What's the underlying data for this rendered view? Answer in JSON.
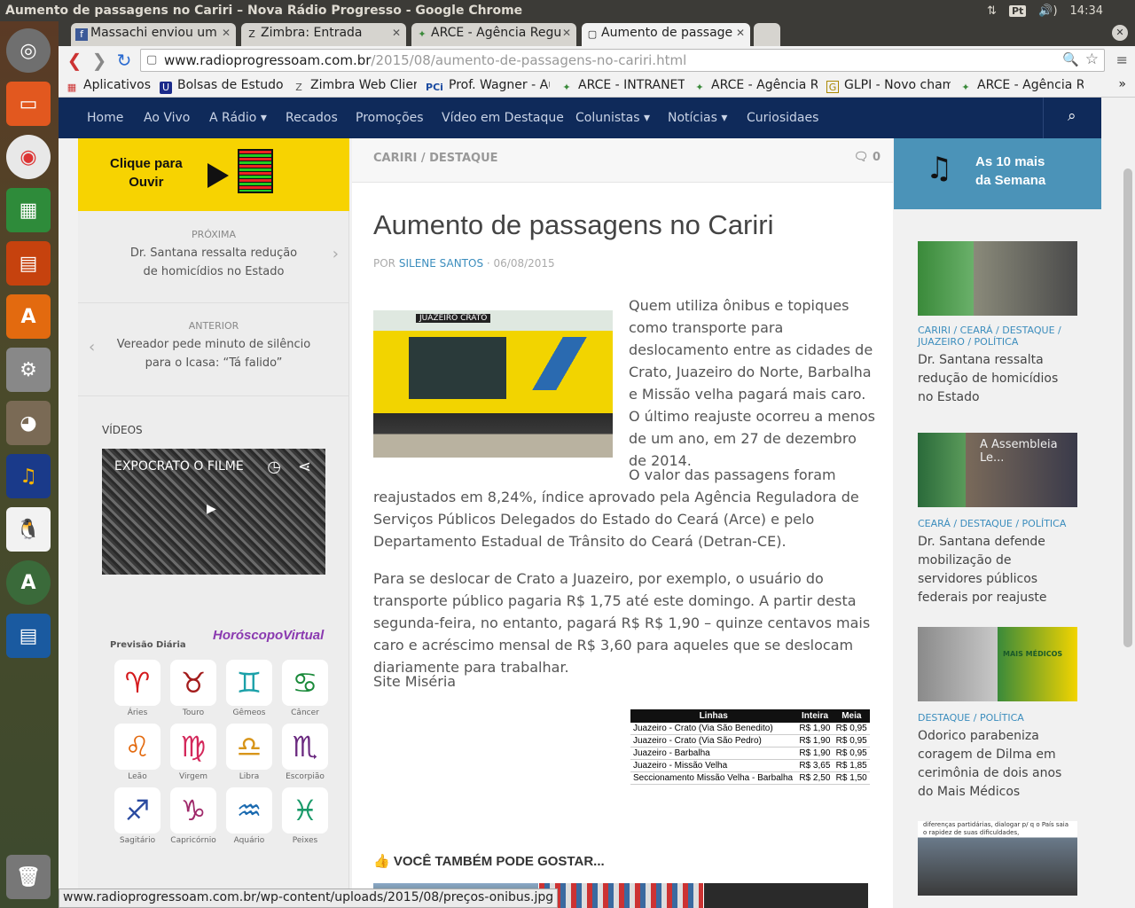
{
  "window": {
    "title": "Aumento de passagens no Cariri – Nova Rádio Progresso - Google Chrome"
  },
  "indicators": {
    "lang": "Pt",
    "volume": "🔊)",
    "clock": "14:34",
    "net": "⇅"
  },
  "tabs": [
    {
      "label": "Massachi enviou um",
      "icon": "f"
    },
    {
      "label": "Zimbra: Entrada",
      "icon": "Z"
    },
    {
      "label": "ARCE - Agência Regu",
      "icon": "✦"
    },
    {
      "label": "Aumento de passage",
      "icon": "▢"
    }
  ],
  "toolbar": {
    "url_host": "www.radioprogressoam.com.br",
    "url_path": "/2015/08/aumento-de-passagens-no-cariri.html"
  },
  "bookmarks": [
    "Aplicativos",
    "Bolsas de Estudo",
    "Zimbra Web Clier",
    "Prof. Wagner - Au",
    "ARCE - INTRANET",
    "ARCE - Agência Re",
    "GLPI - Novo cham",
    "ARCE - Agência Re"
  ],
  "bookmark_icons": [
    "▦",
    "U",
    "Z",
    "PCi",
    "✦",
    "✦",
    "G",
    "✦"
  ],
  "nav": [
    "Home",
    "Ao Vivo",
    "A Rádio ▾",
    "Recados",
    "Promoções",
    "Vídeo em Destaque",
    "Colunistas ▾",
    "Notícias ▾",
    "Curiosidaes"
  ],
  "player": {
    "label1": "Clique para",
    "label2": "Ouvir"
  },
  "postnav": {
    "next_label": "PRÓXIMA",
    "next_title": "Dr. Santana ressalta redução de homicídios no Estado",
    "prev_label": "ANTERIOR",
    "prev_title": "Vereador pede minuto de silêncio para o Icasa: “Tá falido”"
  },
  "videos": {
    "heading": "VÍDEOS",
    "title": "EXPOCRATO O FILME"
  },
  "horoscope": {
    "label": "Previsão Diária",
    "brand": "HoróscopoVirtual",
    "signs": [
      {
        "n": "Áries",
        "g": "♈",
        "c": "#d4181b"
      },
      {
        "n": "Touro",
        "g": "♉",
        "c": "#a31c1c"
      },
      {
        "n": "Gêmeos",
        "g": "♊",
        "c": "#1aa0a8"
      },
      {
        "n": "Câncer",
        "g": "♋",
        "c": "#1a8a3a"
      },
      {
        "n": "Leão",
        "g": "♌",
        "c": "#e36a0f"
      },
      {
        "n": "Virgem",
        "g": "♍",
        "c": "#d4285b"
      },
      {
        "n": "Libra",
        "g": "♎",
        "c": "#d8951a"
      },
      {
        "n": "Escorpião",
        "g": "♏",
        "c": "#6b2a80"
      },
      {
        "n": "Sagitário",
        "g": "♐",
        "c": "#2a4aa0"
      },
      {
        "n": "Capricórnio",
        "g": "♑",
        "c": "#a02a6b"
      },
      {
        "n": "Aquário",
        "g": "♒",
        "c": "#1a6ab0"
      },
      {
        "n": "Peixes",
        "g": "♓",
        "c": "#1a9a6a"
      }
    ]
  },
  "article": {
    "category": "CARIRI / DESTAQUE",
    "comments": "0",
    "title": "Aumento de passagens no Cariri",
    "by": "POR",
    "author": "SILENE SANTOS",
    "date": " · 06/08/2015",
    "p1": "Quem utiliza ônibus e topiques como transporte para deslocamento entre as cidades de Crato, Juazeiro do Norte, Barbalha e Missão velha pagará mais caro.",
    "p1b": "O último reajuste ocorreu a menos de um ano, em 27 de dezembro de 2014.",
    "p2": "O valor das passagens foram reajustados em 8,24%, índice aprovado pela Agência Reguladora de Serviços Públicos Delegados do Estado do Ceará (Arce) e pelo Departamento Estadual de Trânsito do Ceará (Detran-CE).",
    "p3": "Para se deslocar de Crato a Juazeiro, por exemplo, o usuário do transporte público pagaria R$ 1,75 até este domingo. A partir desta segunda-feira, no entanto, pagará R$ R$ 1,90 – quinze centavos mais caro e acréscimo mensal de R$ 3,60 para aqueles que se deslocam diariamente para trabalhar.",
    "source": "Site Miséria",
    "related": "VOCÊ TAMBÉM PODE GOSTAR...",
    "bus_route": "JUAZEIRO CRATO"
  },
  "fares": {
    "headers": [
      "Linhas",
      "Inteira",
      "Meia"
    ],
    "rows": [
      [
        "Juazeiro - Crato (Via São Benedito)",
        "R$ 1,90",
        "R$ 0,95"
      ],
      [
        "Juazeiro - Crato (Via São Pedro)",
        "R$ 1,90",
        "R$ 0,95"
      ],
      [
        "Juazeiro - Barbalha",
        "R$ 1,90",
        "R$ 0,95"
      ],
      [
        "Juazeiro - Missão Velha",
        "R$ 3,65",
        "R$ 1,85"
      ],
      [
        "Seccionamento Missão Velha - Barbalha",
        "R$ 2,50",
        "R$ 1,50"
      ]
    ]
  },
  "sidebar": {
    "heading1": "As 10 mais",
    "heading2": "da Semana",
    "items": [
      {
        "cat": "CARIRI / CEARÁ / DESTAQUE / JUAZEIRO / POLÍTICA",
        "title": "Dr. Santana ressalta redução de homicídios no Estado"
      },
      {
        "cat": "CEARÁ / DESTAQUE / POLÍTICA",
        "title": "Dr. Santana defende mobilização de servidores públicos federais por reajuste"
      },
      {
        "cat": "DESTAQUE / POLÍTICA",
        "title": "Odorico parabeniza coragem de Dilma em cerimônia de dois anos do Mais Médicos"
      }
    ],
    "thumb2_text": "A Assembleia Le...",
    "thumb3_text": "MAIS MÉDICOS",
    "thumb4_text": "diferenças partidárias, dialogar p/ q o País saia o rapidez de suas dificuldades,"
  },
  "status": {
    "url": "www.radioprogressoam.com.br/wp-content/uploads/2015/08/preços-onibus.jpg"
  }
}
